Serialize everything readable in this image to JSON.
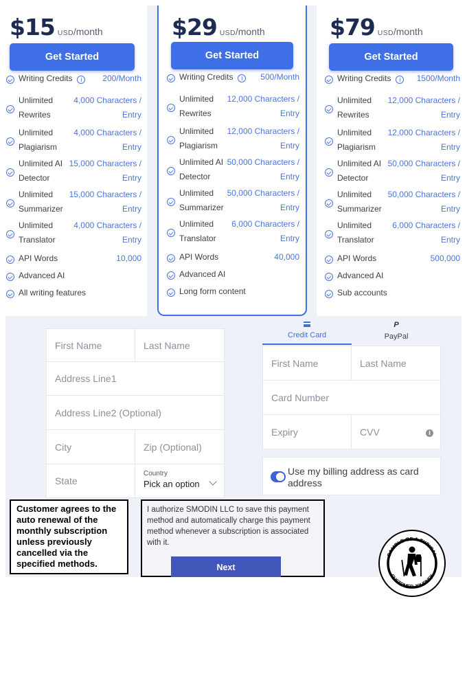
{
  "plans": [
    {
      "amount": "$15",
      "currency": "USD",
      "period": "/month",
      "cta": "Get Started",
      "features": [
        {
          "name": "Writing Credits",
          "info": true,
          "value": "200/Month"
        },
        {
          "name": "Unlimited\nRewrites",
          "value": "4,000 Characters /\nEntry"
        },
        {
          "name": "Unlimited\nPlagiarism",
          "value": "4,000 Characters /\nEntry"
        },
        {
          "name": "Unlimited AI\nDetector",
          "value": "15,000 Characters /\nEntry"
        },
        {
          "name": "Unlimited\nSummarizer",
          "value": "15,000 Characters /\nEntry"
        },
        {
          "name": "Unlimited\nTranslator",
          "value": "4,000 Characters /\nEntry"
        },
        {
          "name": "API Words",
          "value": "10,000"
        },
        {
          "name": "Advanced AI",
          "value": ""
        },
        {
          "name": "All writing features",
          "value": ""
        }
      ]
    },
    {
      "amount": "$29",
      "currency": "USD",
      "period": "/month",
      "cta": "Get Started",
      "features": [
        {
          "name": "Writing Credits",
          "info": true,
          "value": "500/Month"
        },
        {
          "name": "Unlimited\nRewrites",
          "value": "12,000 Characters /\nEntry"
        },
        {
          "name": "Unlimited\nPlagiarism",
          "value": "12,000 Characters /\nEntry"
        },
        {
          "name": "Unlimited AI\nDetector",
          "value": "50,000 Characters /\nEntry"
        },
        {
          "name": "Unlimited\nSummarizer",
          "value": "50,000 Characters /\nEntry"
        },
        {
          "name": "Unlimited\nTranslator",
          "value": "6,000 Characters /\nEntry"
        },
        {
          "name": "API Words",
          "value": "40,000"
        },
        {
          "name": "Advanced AI",
          "value": ""
        },
        {
          "name": "Long form content",
          "value": ""
        }
      ]
    },
    {
      "amount": "$79",
      "currency": "USD",
      "period": "/month",
      "cta": "Get Started",
      "features": [
        {
          "name": "Writing Credits",
          "info": true,
          "value": "1500/Month"
        },
        {
          "name": "Unlimited\nRewrites",
          "value": "12,000 Characters /\nEntry"
        },
        {
          "name": "Unlimited\nPlagiarism",
          "value": "12,000 Characters /\nEntry"
        },
        {
          "name": "Unlimited AI\nDetector",
          "value": "50,000 Characters /\nEntry"
        },
        {
          "name": "Unlimited\nSummarizer",
          "value": "50,000 Characters /\nEntry"
        },
        {
          "name": "Unlimited\nTranslator",
          "value": "6,000 Characters /\nEntry"
        },
        {
          "name": "API Words",
          "value": "500,000"
        },
        {
          "name": "Advanced AI",
          "value": ""
        },
        {
          "name": "Sub accounts",
          "value": ""
        }
      ]
    }
  ],
  "billing_form": {
    "first_name": "First Name",
    "last_name": "Last Name",
    "address1": "Address Line1",
    "address2": "Address Line2 (Optional)",
    "city": "City",
    "zip": "Zip (Optional)",
    "state": "State",
    "country_label": "Country",
    "country_value": "Pick an option"
  },
  "payment": {
    "tab_card": "Credit Card",
    "tab_paypal": "PayPal",
    "paypal_glyph": "P",
    "first_name": "First Name",
    "last_name": "Last Name",
    "card_number": "Card Number",
    "expiry": "Expiry",
    "cvv": "CVV",
    "cvv_info": "i",
    "toggle_label": "Use my billing address as card address",
    "authorization": "I authorize SMODIN LLC to save this payment method and automatically charge this payment method whenever a subscription is associated with it.",
    "next": "Next"
  },
  "annotation": {
    "text": "Customer agrees to the auto renewal of the monthly subscription unless previously cancelled via the specified methods."
  },
  "stamp": {
    "top_text": "SAMPLE OF A TYPICAL",
    "bottom_text": "CUSTOMER JOURNEY"
  }
}
